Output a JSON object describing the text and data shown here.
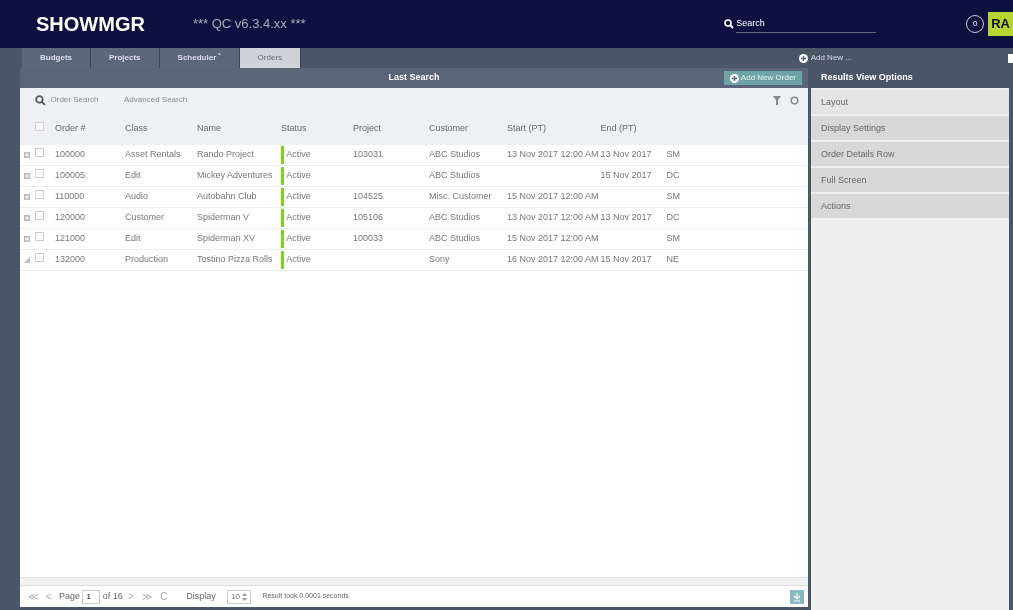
{
  "header": {
    "logo": "SHOWMGR",
    "environment": "*** QC v6.3.4.xx ***",
    "search": {
      "placeholder": "Search"
    },
    "notifications": "0",
    "user_initials": "RA"
  },
  "tabs": [
    {
      "label": "Budgets",
      "selected": false
    },
    {
      "label": "Projects",
      "selected": false
    },
    {
      "label": "Scheduler",
      "selected": false,
      "badge": "*"
    },
    {
      "label": "Orders",
      "selected": true
    }
  ],
  "add_new": "Add New ...",
  "panel": {
    "title": "Last Search",
    "add_button": "Add New Order",
    "search_tabs": [
      "Order Search",
      "Advanced Search"
    ]
  },
  "table": {
    "all_checked": false,
    "columns": [
      "Order #",
      "Class",
      "Name",
      "Status",
      "Project",
      "Customer",
      "Start (PT)",
      "End (PT)"
    ],
    "rows": [
      {
        "expanded": false,
        "checked": false,
        "color": "#7ed321",
        "cells": [
          "100000",
          "Asset Rentals",
          "Rando Project",
          "Active",
          "103031",
          "ABC Studios",
          "13 Nov 2017 12:00 AM",
          "13 Nov 2017",
          "SM"
        ]
      },
      {
        "expanded": false,
        "checked": false,
        "color": "#7ed321",
        "cells": [
          "100005",
          "Edit",
          "Mickey Adventures",
          "Active",
          "",
          "ABC Studios",
          "",
          "15 Nov 2017",
          "DC"
        ]
      },
      {
        "expanded": false,
        "checked": false,
        "color": "#7ed321",
        "cells": [
          "110000",
          "Audio",
          "Autobahn Club",
          "Active",
          "104525",
          "Misc. Customer",
          "15 Nov 2017 12:00 AM",
          "",
          "SM"
        ]
      },
      {
        "expanded": false,
        "checked": false,
        "color": "#7ed321",
        "cells": [
          "120000",
          "Customer",
          "Spiderman V",
          "Active",
          "105106",
          "ABC Studios",
          "13 Nov 2017 12:00 AM",
          "13 Nov 2017",
          "DC"
        ]
      },
      {
        "expanded": false,
        "checked": false,
        "color": "#7ed321",
        "cells": [
          "121000",
          "Edit",
          "Spiderman XV",
          "Active",
          "100033",
          "ABC Studios",
          "15 Nov 2017 12:00 AM",
          "",
          "SM"
        ]
      },
      {
        "expanded": true,
        "checked": false,
        "color": "#7ed321",
        "cells": [
          "132000",
          "Production",
          "Tostino Pizza Rolls",
          "Active",
          "",
          "Sony",
          "16 Nov 2017 12:00 AM",
          "15 Nov 2017",
          "NE"
        ]
      }
    ]
  },
  "pager": {
    "first": "≪",
    "prev": "<",
    "page_label": "Page",
    "page": "1",
    "of": "of 16",
    "next": ">",
    "last": "≫",
    "refresh": "C",
    "display_label": "Display",
    "page_size": "10",
    "result": "Result took 0.0001 seconds"
  },
  "options": {
    "title": "Results View Options",
    "items": [
      {
        "label": "Layout",
        "selected": true
      },
      {
        "label": "Display Settings",
        "selected": false
      },
      {
        "label": "Order Details Row",
        "selected": false
      },
      {
        "label": "Full Screen",
        "selected": false
      },
      {
        "label": "Actions",
        "selected": false
      }
    ]
  }
}
